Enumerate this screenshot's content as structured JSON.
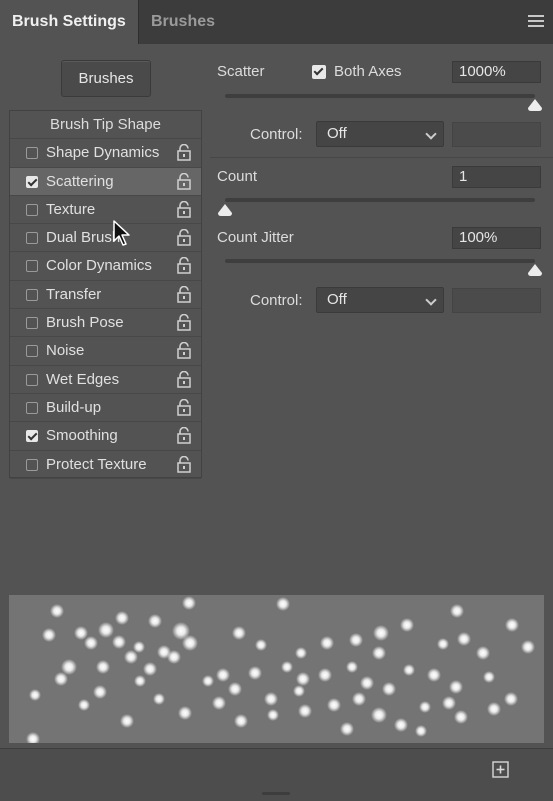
{
  "tabs": {
    "active": "Brush Settings",
    "inactive": "Brushes"
  },
  "brushes_button": "Brushes",
  "options": [
    {
      "label": "Brush Tip Shape",
      "checked": null,
      "lock": false
    },
    {
      "label": "Shape Dynamics",
      "checked": false,
      "lock": true
    },
    {
      "label": "Scattering",
      "checked": true,
      "lock": true,
      "selected": true
    },
    {
      "label": "Texture",
      "checked": false,
      "lock": true
    },
    {
      "label": "Dual Brush",
      "checked": false,
      "lock": true
    },
    {
      "label": "Color Dynamics",
      "checked": false,
      "lock": true
    },
    {
      "label": "Transfer",
      "checked": false,
      "lock": true
    },
    {
      "label": "Brush Pose",
      "checked": false,
      "lock": true
    },
    {
      "label": "Noise",
      "checked": false,
      "lock": true
    },
    {
      "label": "Wet Edges",
      "checked": false,
      "lock": true
    },
    {
      "label": "Build-up",
      "checked": false,
      "lock": true
    },
    {
      "label": "Smoothing",
      "checked": true,
      "lock": true
    },
    {
      "label": "Protect Texture",
      "checked": false,
      "lock": true
    }
  ],
  "scatter": {
    "label": "Scatter",
    "both_axes_label": "Both Axes",
    "both_axes_checked": true,
    "value": "1000%",
    "slider_fraction": 1.0,
    "control_label": "Control:",
    "control_value": "Off"
  },
  "count": {
    "label": "Count",
    "value": "1",
    "slider_fraction": 0.0
  },
  "count_jitter": {
    "label": "Count Jitter",
    "value": "100%",
    "slider_fraction": 1.0,
    "control_label": "Control:",
    "control_value": "Off"
  },
  "icons": {
    "menu": "hamburger-menu-icon",
    "lock": "lock-icon",
    "new": "new-brush-icon",
    "cursor": "mouse-cursor-icon"
  }
}
